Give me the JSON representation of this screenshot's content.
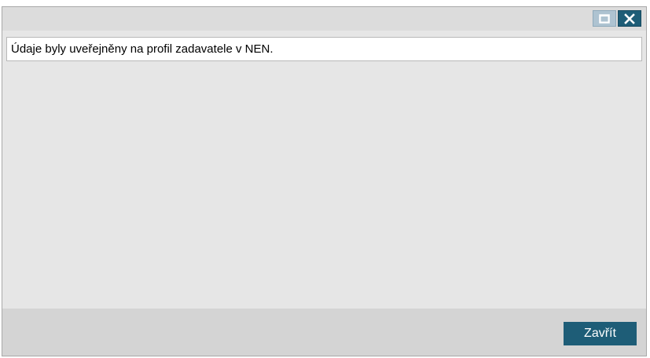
{
  "dialog": {
    "controls": {
      "maximize_icon": "maximize-icon",
      "close_icon": "close-icon"
    },
    "message": "Údaje byly uveřejněny na profil zadavatele v NEN.",
    "footer": {
      "close_label": "Zavřít"
    }
  },
  "colors": {
    "accent": "#1e5d77",
    "maximize_bg": "#aec3d1",
    "dialog_bg": "#e6e6e6",
    "footer_bg": "#d4d4d4"
  }
}
